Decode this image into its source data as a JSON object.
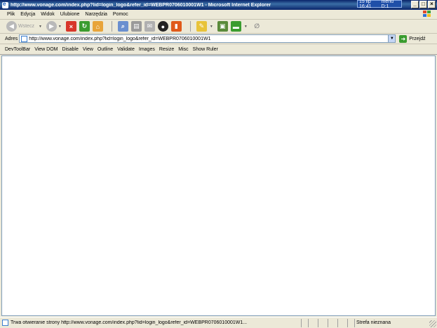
{
  "window": {
    "title": "http://www.vonage.com/index.php?lid=login_logo&refer_id=WEBPR0706010001W1 - Microsoft Internet Explorer",
    "tray_time": "15 lip 16:41",
    "tray_menu": "menu D:1"
  },
  "menu": {
    "items": [
      "Plik",
      "Edycja",
      "Widok",
      "Ulubione",
      "Narzędzia",
      "Pomoc"
    ]
  },
  "toolbar": {
    "back_label": "Wstecz"
  },
  "address": {
    "label": "Adres",
    "url": "http://www.vonage.com/index.php?lid=login_logo&refer_id=WEBPR0706010001W1",
    "go_label": "Przejdź"
  },
  "devtoolbar": {
    "items": [
      "DevToolBar",
      "View DOM",
      "Disable",
      "View",
      "Outline",
      "Validate",
      "Images",
      "Resize",
      "Misc",
      "Show Ruler"
    ]
  },
  "status": {
    "text": "Trwa otwieranie strony http://www.vonage.com/index.php?lid=login_logo&refer_id=WEBPR0706010001W1...",
    "zone": "Strefa nieznana"
  },
  "colors": {
    "title_bar": "#0a246a",
    "chrome": "#ece9d8",
    "go_green": "#3a9c2f"
  }
}
